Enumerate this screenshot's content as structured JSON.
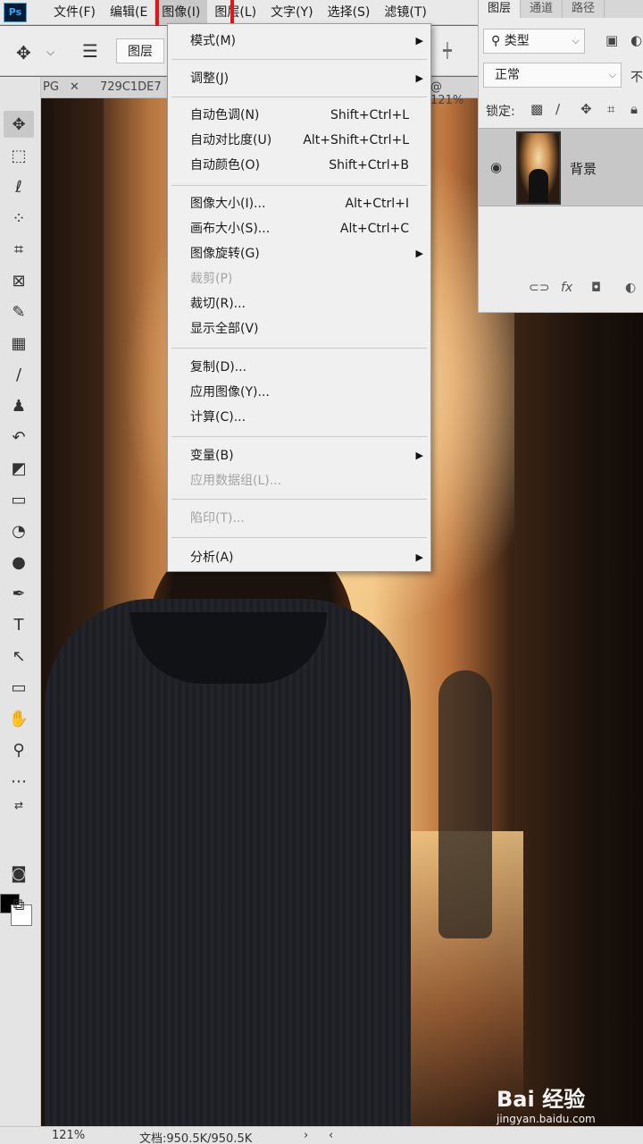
{
  "app": {
    "logo": "Ps"
  },
  "menubar": {
    "items": [
      {
        "label": "文件(F)"
      },
      {
        "label": "编辑(E"
      },
      {
        "label": "图像(I)"
      },
      {
        "label": "图层(L)"
      },
      {
        "label": "文字(Y)"
      },
      {
        "label": "选择(S)"
      },
      {
        "label": "滤镜(T)"
      }
    ],
    "active_index": 2
  },
  "options": {
    "layer_select": "图层"
  },
  "document_tabs": {
    "tab1": "PG",
    "tab2": "729C1DE7",
    "zoom": "@ 121%"
  },
  "image_menu": {
    "items": [
      {
        "label": "模式(M)",
        "submenu": true
      },
      {
        "label": "调整(J)",
        "submenu": true
      },
      {
        "label": "自动色调(N)",
        "shortcut": "Shift+Ctrl+L"
      },
      {
        "label": "自动对比度(U)",
        "shortcut": "Alt+Shift+Ctrl+L"
      },
      {
        "label": "自动颜色(O)",
        "shortcut": "Shift+Ctrl+B"
      },
      {
        "label": "图像大小(I)...",
        "shortcut": "Alt+Ctrl+I"
      },
      {
        "label": "画布大小(S)...",
        "shortcut": "Alt+Ctrl+C"
      },
      {
        "label": "图像旋转(G)",
        "submenu": true
      },
      {
        "label": "裁剪(P)",
        "disabled": true
      },
      {
        "label": "裁切(R)..."
      },
      {
        "label": "显示全部(V)"
      },
      {
        "label": "复制(D)..."
      },
      {
        "label": "应用图像(Y)..."
      },
      {
        "label": "计算(C)..."
      },
      {
        "label": "变量(B)",
        "submenu": true
      },
      {
        "label": "应用数据组(L)...",
        "disabled": true
      },
      {
        "label": "陷印(T)...",
        "disabled": true
      },
      {
        "label": "分析(A)",
        "submenu": true
      }
    ]
  },
  "layers_panel": {
    "tabs": [
      "图层",
      "通道",
      "路径"
    ],
    "kind_filter": "类型",
    "blend_mode": "正常",
    "opacity_label_cut": "不",
    "lock_label": "锁定:",
    "layer_name": "背景"
  },
  "statusbar": {
    "zoom": "121%",
    "doc_info": "文档:950.5K/950.5K"
  },
  "watermark": {
    "logo": "Bai 经验",
    "url": "jingyan.baidu.com"
  }
}
